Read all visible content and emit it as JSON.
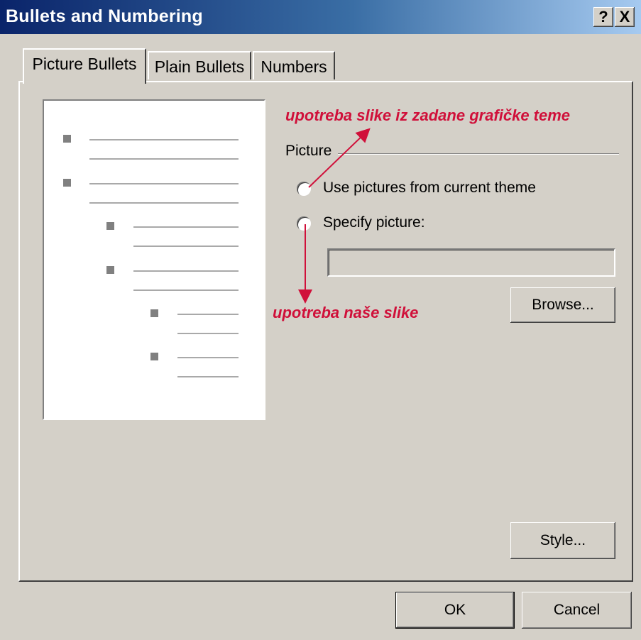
{
  "window": {
    "title": "Bullets and Numbering",
    "help_label": "?",
    "close_label": "X"
  },
  "tabs": [
    {
      "label": "Picture Bullets",
      "active": true
    },
    {
      "label": "Plain Bullets",
      "active": false
    },
    {
      "label": "Numbers",
      "active": false
    }
  ],
  "picture_group": {
    "label": "Picture",
    "options": [
      {
        "label": "Use pictures from current theme",
        "selected": false
      },
      {
        "label": "Specify picture:",
        "selected": false
      }
    ],
    "picture_path_value": "",
    "browse_label": "Browse..."
  },
  "style_label": "Style...",
  "footer": {
    "ok_label": "OK",
    "cancel_label": "Cancel"
  },
  "annotations": {
    "theme_note": "upotreba slike iz zadane grafičke teme",
    "own_note": "upotreba naše slike",
    "color": "#d0103a"
  }
}
